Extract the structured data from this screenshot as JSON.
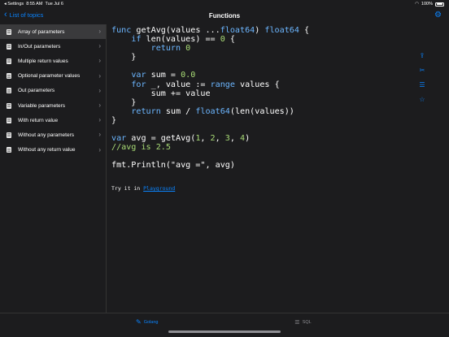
{
  "status": {
    "time": "8:55 AM",
    "date": "Tue Jul 6",
    "back_app": "◂ Settings",
    "battery": "100%"
  },
  "nav": {
    "back_label": "List of topics",
    "title": "Functions"
  },
  "sidebar": {
    "items": [
      {
        "label": "Array of parameters",
        "selected": true
      },
      {
        "label": "In/Out parameters"
      },
      {
        "label": "Multiple return values"
      },
      {
        "label": "Optional parameter values"
      },
      {
        "label": "Out parameters"
      },
      {
        "label": "Variable parameters"
      },
      {
        "label": "With return value"
      },
      {
        "label": "Without any parameters"
      },
      {
        "label": "Without any return value"
      }
    ]
  },
  "code": {
    "lines": [
      "func getAvg(values ...float64) float64 {",
      "    if len(values) == 0 {",
      "        return 0",
      "    }",
      "",
      "    var sum = 0.0",
      "    for _, value := range values {",
      "        sum += value",
      "    }",
      "    return sum / float64(len(values))",
      "}",
      "",
      "var avg = getAvg(1, 2, 3, 4)",
      "//avg is 2.5",
      "",
      "fmt.Println(\"avg =\", avg)"
    ],
    "try_prefix": "Try it in ",
    "try_link": "Playground"
  },
  "tabs": [
    {
      "label": "Golang",
      "active": true
    },
    {
      "label": "SQL",
      "active": false
    }
  ],
  "colors": {
    "accent": "#0a84ff",
    "keyword": "#6cb6ff",
    "number": "#a9dc76",
    "background": "#1c1c1e"
  }
}
